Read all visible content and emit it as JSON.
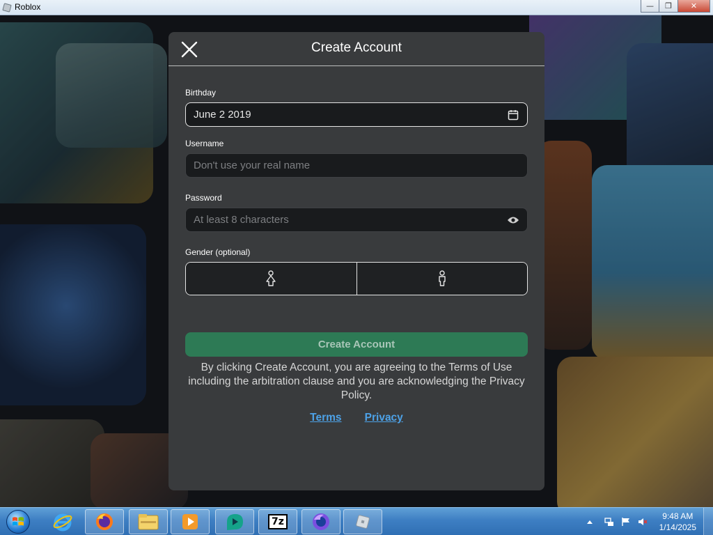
{
  "window": {
    "title": "Roblox",
    "minimize": "—",
    "maximize": "❐",
    "close": "✕"
  },
  "modal": {
    "title": "Create Account",
    "birthday": {
      "label": "Birthday",
      "value": "June 2 2019"
    },
    "username": {
      "label": "Username",
      "placeholder": "Don't use your real name"
    },
    "password": {
      "label": "Password",
      "placeholder": "At least 8 characters"
    },
    "gender": {
      "label": "Gender (optional)",
      "options": [
        "female-icon",
        "male-icon"
      ]
    },
    "create_button": "Create Account",
    "legal_text": "By clicking Create Account, you are agreeing to the Terms of Use including the arbitration clause and you are acknowledging the Privacy Policy.",
    "links": {
      "terms": "Terms",
      "privacy": "Privacy"
    }
  },
  "taskbar": {
    "apps": [
      "internet-explorer-icon",
      "firefox-icon",
      "file-explorer-icon",
      "media-player-icon",
      "app-icon",
      "7zip-icon",
      "firefox-nightly-icon",
      "roblox-icon"
    ],
    "sevenzip_label": "7z",
    "clock": {
      "time": "9:48 AM",
      "date": "1/14/2025"
    }
  },
  "colors": {
    "accent_green": "#2d7a55",
    "link_blue": "#4da2e8",
    "modal_bg": "#393b3d"
  }
}
